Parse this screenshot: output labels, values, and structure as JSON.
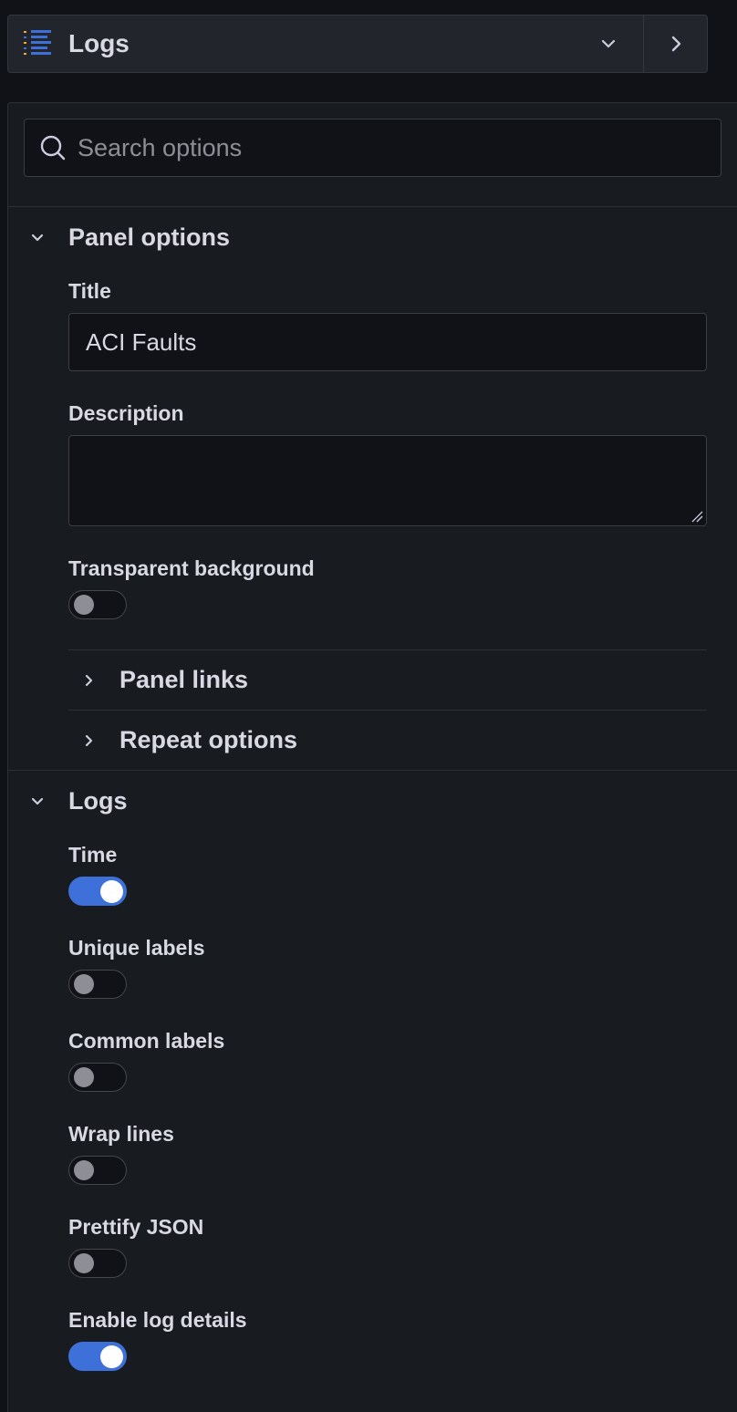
{
  "viz_picker": {
    "title": "Logs",
    "icon": "logs-list-icon",
    "accent_color": "#3d71d9"
  },
  "search": {
    "placeholder": "Search options",
    "value": ""
  },
  "panel_options": {
    "title": "Panel options",
    "expanded": true,
    "title_field": {
      "label": "Title",
      "value": "ACI Faults"
    },
    "description_field": {
      "label": "Description",
      "value": ""
    },
    "transparent_background": {
      "label": "Transparent background",
      "checked": false
    },
    "sub_sections": [
      {
        "label": "Panel links",
        "expanded": false
      },
      {
        "label": "Repeat options",
        "expanded": false
      }
    ]
  },
  "logs_options": {
    "title": "Logs",
    "expanded": true,
    "toggles": [
      {
        "label": "Time",
        "checked": true
      },
      {
        "label": "Unique labels",
        "checked": false
      },
      {
        "label": "Common labels",
        "checked": false
      },
      {
        "label": "Wrap lines",
        "checked": false
      },
      {
        "label": "Prettify JSON",
        "checked": false
      },
      {
        "label": "Enable log details",
        "checked": true
      }
    ]
  }
}
